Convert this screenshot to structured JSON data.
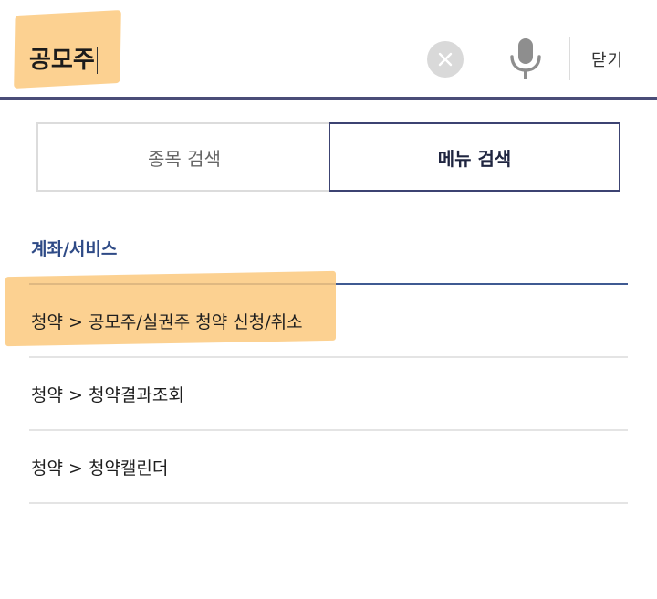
{
  "search": {
    "query": "공모주",
    "close_label": "닫기"
  },
  "tabs": [
    {
      "label": "종목 검색",
      "selected": false
    },
    {
      "label": "메뉴 검색",
      "selected": true
    }
  ],
  "results": {
    "section_title": "계좌/서비스",
    "items": [
      {
        "label": "청약 > 공모주/실권주 청약 신청/취소"
      },
      {
        "label": "청약 > 청약결과조회"
      },
      {
        "label": "청약 > 청약캘린더"
      }
    ]
  },
  "colors": {
    "accent": "#4a4d78",
    "section_title": "#2e4a86",
    "highlight": "#fbc97e"
  },
  "icons": {
    "clear": "clear-icon",
    "mic": "microphone-icon"
  }
}
